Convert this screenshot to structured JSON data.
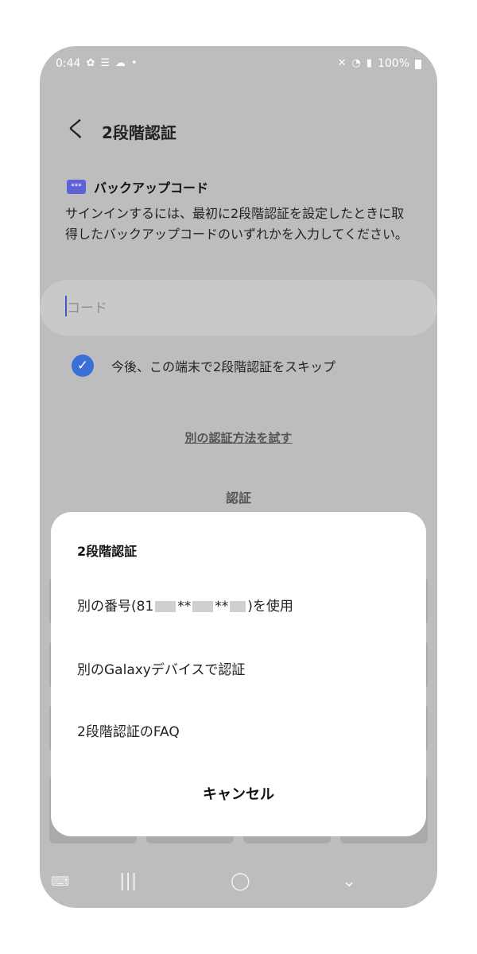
{
  "status_bar": {
    "time": "0:44",
    "battery": "100%"
  },
  "header": {
    "back_label": "く",
    "title": "2段階認証"
  },
  "backup": {
    "icon_text": "***",
    "title": "バックアップコード",
    "description": "サインインするには、最初に2段階認証を設定したときに取得したバックアップコードのいずれかを入力してください。"
  },
  "code_input": {
    "placeholder": "コード",
    "value": ""
  },
  "skip_checkbox": {
    "label": "今後、この端末で2段階認証をスキップ",
    "checked": true
  },
  "alt_link": "別の認証方法を試す",
  "verify_button": "認証",
  "sheet": {
    "title": "2段階認証",
    "item_phone_prefix": "別の番号(81",
    "item_phone_suffix": ")を使用",
    "item_phone_stars": "**",
    "item_galaxy": "別のGalaxyデバイスで認証",
    "item_faq": "2段階認証のFAQ",
    "cancel": "キャンセル"
  },
  "icons": {
    "accent": "#3a6fd8",
    "backup_icon_color": "#5d63d6"
  }
}
